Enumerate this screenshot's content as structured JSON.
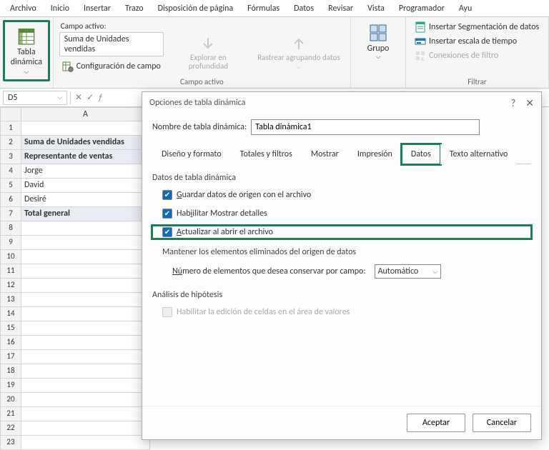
{
  "menu": [
    "Archivo",
    "Inicio",
    "Insertar",
    "Trazo",
    "Disposición de página",
    "Fórmulas",
    "Datos",
    "Revisar",
    "Vista",
    "Programador",
    "Ayu"
  ],
  "ribbon": {
    "pivot_btn_top": "Tabla",
    "pivot_btn_bottom": "dinámica",
    "active_field_label": "Campo activo:",
    "active_field_value": "Suma de Unidades vendidas",
    "field_settings": "Configuración de campo",
    "drill": "Explorar en profundidad",
    "collapse": "Rastrear agrupando datos",
    "group": "Grupo",
    "insert_slicer": "Insertar Segmentación de datos",
    "insert_timeline": "Insertar escala de tiempo",
    "filter_conn": "Conexiones de filtro",
    "group_labels": {
      "active": "Campo activo",
      "filter": "Filtrar"
    }
  },
  "namebox": "D5",
  "columns": [
    "A"
  ],
  "rows": [
    {
      "n": 1,
      "val": "",
      "bold": false,
      "shaded": false
    },
    {
      "n": 2,
      "val": "Suma de Unidades vendidas",
      "bold": true,
      "shaded": true
    },
    {
      "n": 3,
      "val": "Representante de ventas",
      "bold": true,
      "shaded": true
    },
    {
      "n": 4,
      "val": "Jorge",
      "bold": false,
      "shaded": false
    },
    {
      "n": 5,
      "val": "David",
      "bold": false,
      "shaded": false
    },
    {
      "n": 6,
      "val": "Desiré",
      "bold": false,
      "shaded": false
    },
    {
      "n": 7,
      "val": "Total general",
      "bold": true,
      "shaded": true
    },
    {
      "n": 8,
      "val": "",
      "bold": false,
      "shaded": false
    },
    {
      "n": 9,
      "val": "",
      "bold": false,
      "shaded": false
    },
    {
      "n": 10,
      "val": "",
      "bold": false,
      "shaded": false
    },
    {
      "n": 11,
      "val": "",
      "bold": false,
      "shaded": false
    },
    {
      "n": 12,
      "val": "",
      "bold": false,
      "shaded": false
    },
    {
      "n": 13,
      "val": "",
      "bold": false,
      "shaded": false
    },
    {
      "n": 14,
      "val": "",
      "bold": false,
      "shaded": false
    },
    {
      "n": 15,
      "val": "",
      "bold": false,
      "shaded": false
    },
    {
      "n": 16,
      "val": "",
      "bold": false,
      "shaded": false
    },
    {
      "n": 17,
      "val": "",
      "bold": false,
      "shaded": false
    },
    {
      "n": 18,
      "val": "",
      "bold": false,
      "shaded": false
    },
    {
      "n": 19,
      "val": "",
      "bold": false,
      "shaded": false
    },
    {
      "n": 20,
      "val": "",
      "bold": false,
      "shaded": false
    },
    {
      "n": 21,
      "val": "",
      "bold": false,
      "shaded": false
    },
    {
      "n": 22,
      "val": "",
      "bold": false,
      "shaded": false
    },
    {
      "n": 23,
      "val": "",
      "bold": false,
      "shaded": false
    }
  ],
  "dialog": {
    "title": "Opciones de tabla dinámica",
    "name_label": "Nombre de tabla dinámica:",
    "name_value": "Tabla dinámica1",
    "tabs": [
      "Diseño y formato",
      "Totales y filtros",
      "Mostrar",
      "Impresión",
      "Datos",
      "Texto alternativo"
    ],
    "active_tab": 4,
    "section1": "Datos de tabla dinámica",
    "chk_save": "uardar datos de origen con el archivo",
    "chk_save_u": "G",
    "chk_show": "ilitar Mostrar detalles",
    "chk_show_u": "Hab",
    "chk_refresh": "ctualizar al abrir el archivo",
    "chk_refresh_u": "A",
    "retain_label": "Mantener los elementos eliminados del origen de datos",
    "retain_count": "mero de elementos que desea conservar por campo:",
    "retain_count_u": "Nú",
    "retain_value": "Automático",
    "section2": "Análisis de hipótesis",
    "chk_whatif": "Habilitar la edición de celdas en el área de valores",
    "ok": "Aceptar",
    "cancel": "Cancelar"
  }
}
